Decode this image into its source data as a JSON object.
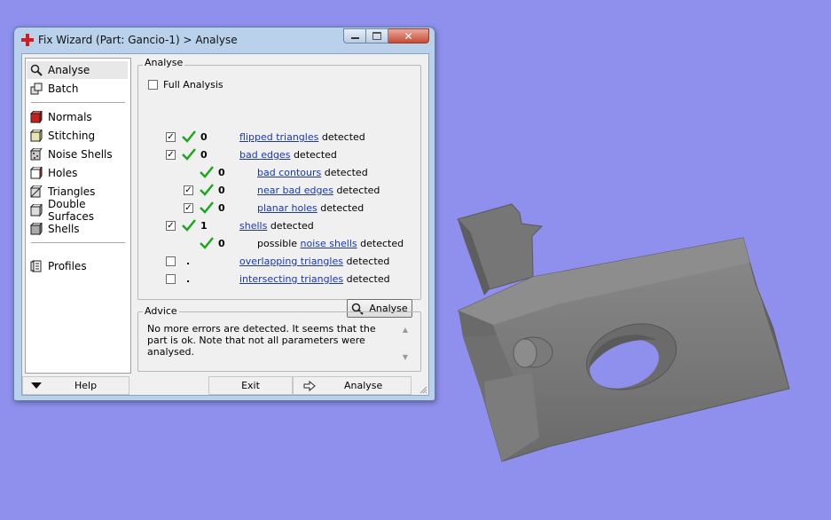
{
  "window": {
    "title": "Fix Wizard (Part: Gancio-1) > Analyse"
  },
  "nav": {
    "items": [
      {
        "label": "Analyse",
        "icon": "magnifier-icon",
        "selected": true
      },
      {
        "label": "Batch",
        "icon": "batch-icon"
      },
      {
        "label": "Normals",
        "icon": "normals-icon"
      },
      {
        "label": "Stitching",
        "icon": "stitching-icon"
      },
      {
        "label": "Noise Shells",
        "icon": "noise-shells-icon"
      },
      {
        "label": "Holes",
        "icon": "holes-icon"
      },
      {
        "label": "Triangles",
        "icon": "triangles-icon"
      },
      {
        "label": "Double Surfaces",
        "icon": "double-surfaces-icon"
      },
      {
        "label": "Shells",
        "icon": "shells-icon"
      },
      {
        "label": "Profiles",
        "icon": "profiles-icon"
      }
    ]
  },
  "analyse": {
    "group_label": "Analyse",
    "full_analysis": {
      "label": "Full Analysis",
      "checked": false
    },
    "detected_word": "detected",
    "possible_word": "possible",
    "rows": [
      {
        "checked": true,
        "count": "0",
        "link": "flipped triangles"
      },
      {
        "checked": true,
        "count": "0",
        "link": "bad edges"
      },
      {
        "checked": null,
        "count": "0",
        "link": "bad contours"
      },
      {
        "checked": true,
        "count": "0",
        "link": "near bad edges"
      },
      {
        "checked": true,
        "count": "0",
        "link": "planar holes"
      },
      {
        "checked": true,
        "count": "1",
        "link": "shells"
      },
      {
        "checked": null,
        "count": "0",
        "link": "noise shells"
      },
      {
        "checked": false,
        "count": ".",
        "link": "overlapping triangles"
      },
      {
        "checked": false,
        "count": ".",
        "link": "intersecting triangles"
      }
    ],
    "analyse_button": "Analyse"
  },
  "advice": {
    "label": "Advice",
    "text": "No more errors are detected. It seems that the part is ok. Note that not all parameters were analysed."
  },
  "footer": {
    "help": "Help",
    "exit": "Exit",
    "analyse": "Analyse"
  },
  "colors": {
    "background": "#8f8fee",
    "link": "#1a37b9",
    "tick": "#1fa51f",
    "part": "#7a7a7a"
  }
}
